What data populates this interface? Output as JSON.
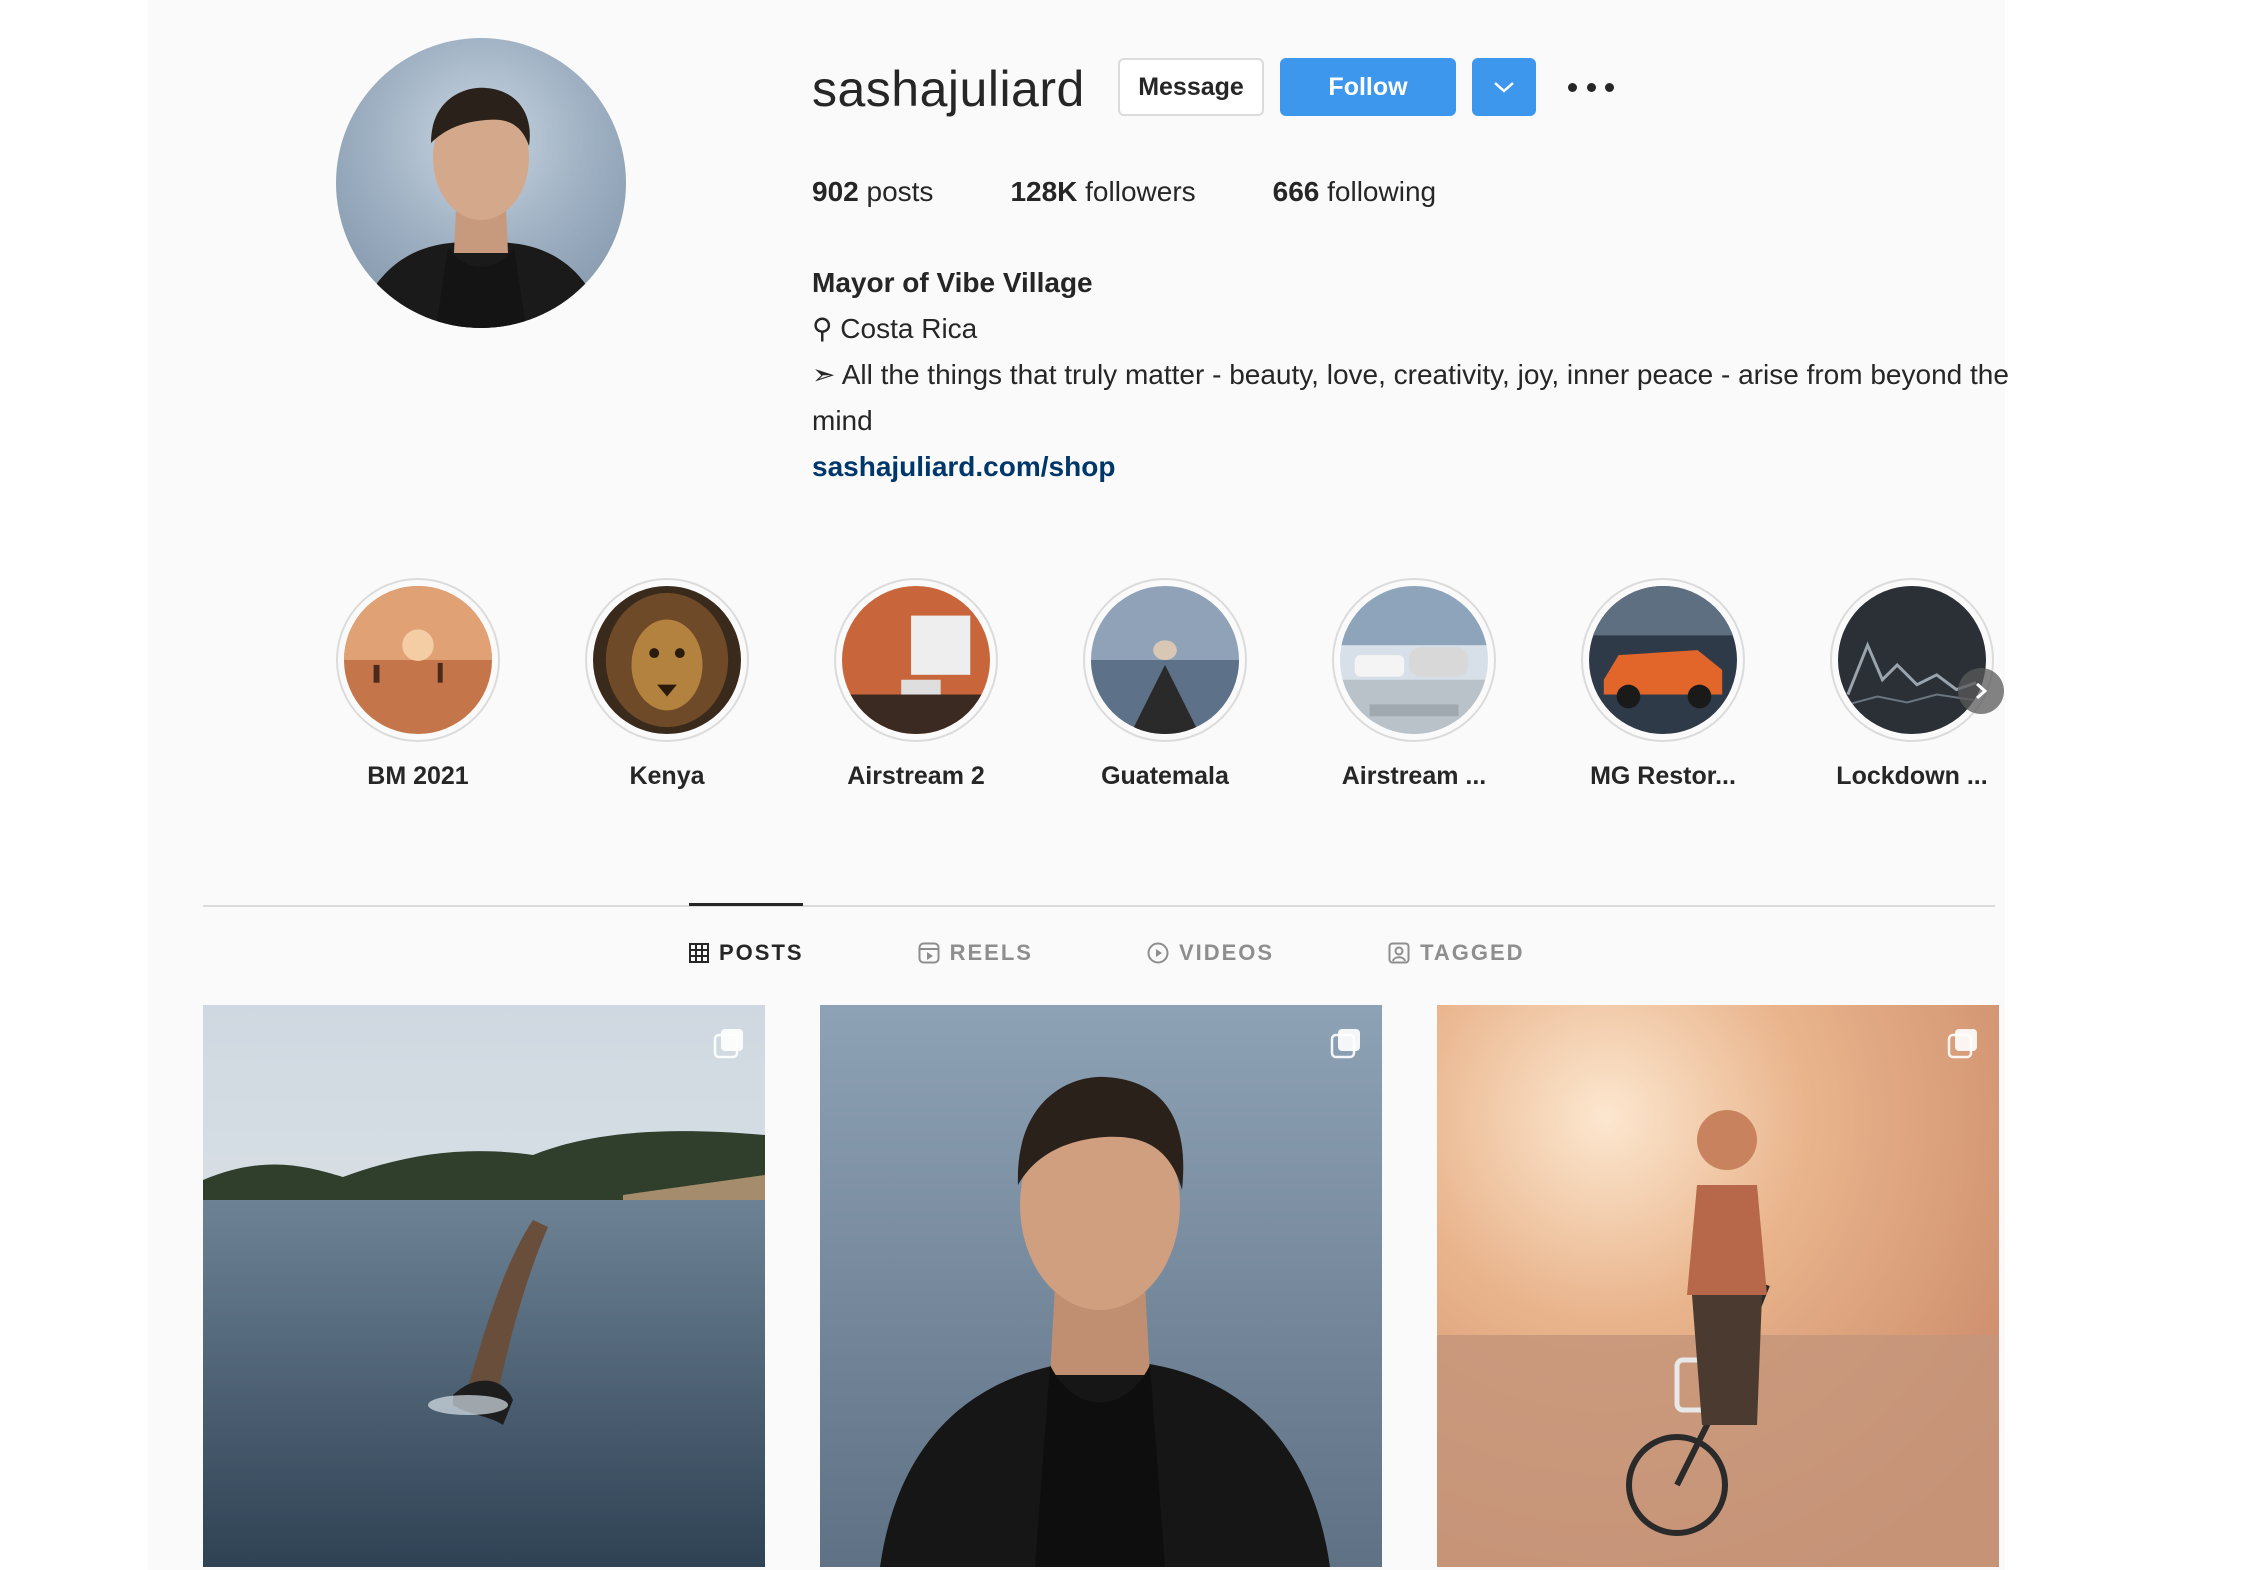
{
  "profile": {
    "username": "sashajuliard",
    "buttons": {
      "message": "Message",
      "follow": "Follow"
    },
    "stats": [
      {
        "value": "902",
        "label": "posts"
      },
      {
        "value": "128K",
        "label": "followers"
      },
      {
        "value": "666",
        "label": "following"
      }
    ],
    "bio": {
      "name": "Mayor of Vibe Village",
      "location_glyph": "⚲",
      "location": "Costa Rica",
      "quote_glyph": "➣",
      "quote": "All the things that truly matter - beauty, love, creativity, joy, inner peace - arise from beyond the mind",
      "link": "sashajuliard.com/shop"
    }
  },
  "highlights": [
    {
      "label": "BM 2021"
    },
    {
      "label": "Kenya"
    },
    {
      "label": "Airstream 2"
    },
    {
      "label": "Guatemala"
    },
    {
      "label": "Airstream ..."
    },
    {
      "label": "MG Restor..."
    },
    {
      "label": "Lockdown ..."
    }
  ],
  "tabs": [
    {
      "label": "POSTS",
      "icon": "grid-icon",
      "active": true
    },
    {
      "label": "REELS",
      "icon": "reels-icon",
      "active": false
    },
    {
      "label": "VIDEOS",
      "icon": "play-icon",
      "active": false
    },
    {
      "label": "TAGGED",
      "icon": "tagged-icon",
      "active": false
    }
  ],
  "colors": {
    "follow_blue": "#3d97ed",
    "link_blue": "#00376b",
    "text": "#262626",
    "muted": "#8e8e8e",
    "border": "#dbdbdb"
  }
}
